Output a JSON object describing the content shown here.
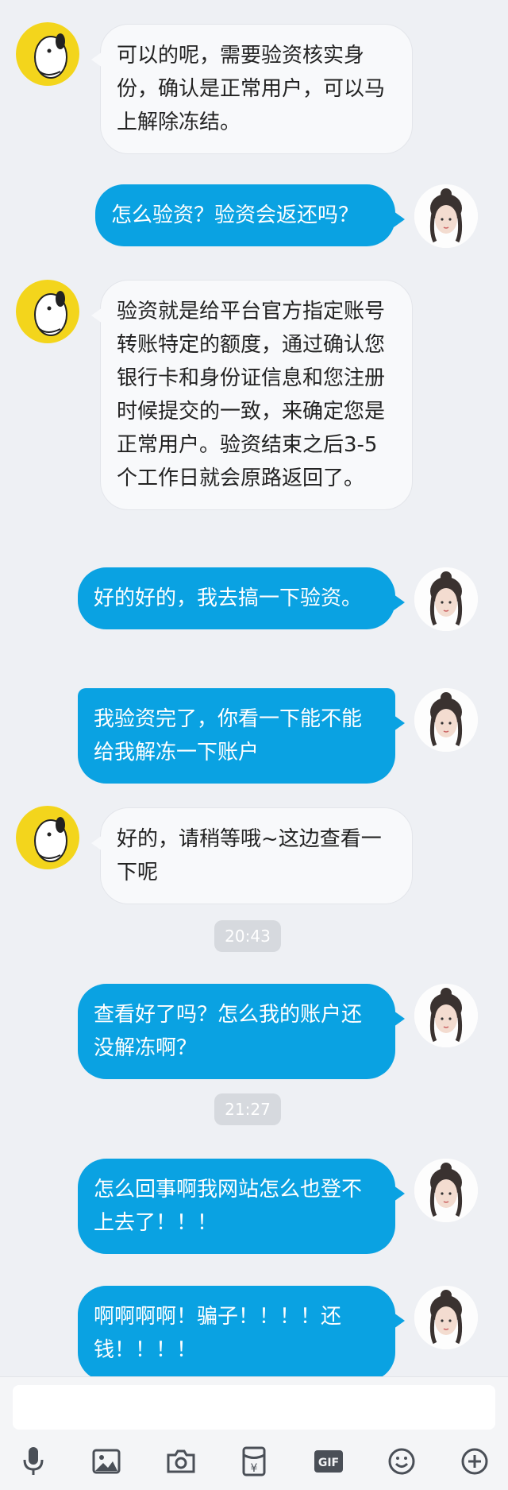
{
  "messages": [
    {
      "side": "in",
      "text": "可以的呢，需要验资核实身份，确认是正常用户，可以马上解除冻结。"
    },
    {
      "side": "out",
      "text": "怎么验资？验资会返还吗？"
    },
    {
      "side": "in",
      "text": "验资就是给平台官方指定账号转账特定的额度，通过确认您银行卡和身份证信息和您注册时候提交的一致，来确定您是正常用户。验资结束之后3-5个工作日就会原路返回了。"
    },
    {
      "side": "out",
      "text": "好的好的，我去搞一下验资。"
    },
    {
      "side": "out",
      "text": "我验资完了，你看一下能不能给我解冻一下账户"
    },
    {
      "side": "in",
      "text": "好的，请稍等哦~这边查看一下呢"
    },
    {
      "time": "20:43"
    },
    {
      "side": "out",
      "text": "查看好了吗？怎么我的账户还没解冻啊？"
    },
    {
      "time": "21:27"
    },
    {
      "side": "out",
      "text": "怎么回事啊我网站怎么也登不上去了！！！"
    },
    {
      "side": "out",
      "text": "啊啊啊啊！骗子！！！！还钱！！！！"
    }
  ],
  "input": {
    "value": "",
    "placeholder": ""
  },
  "toolbar": [
    "mic-icon",
    "image-icon",
    "camera-icon",
    "red-packet-icon",
    "gif-icon",
    "emoji-icon",
    "plus-icon"
  ],
  "colors": {
    "outgoing_bubble": "#0aa2e2",
    "incoming_bubble": "#f8f9fb",
    "background": "#eef0f4"
  }
}
